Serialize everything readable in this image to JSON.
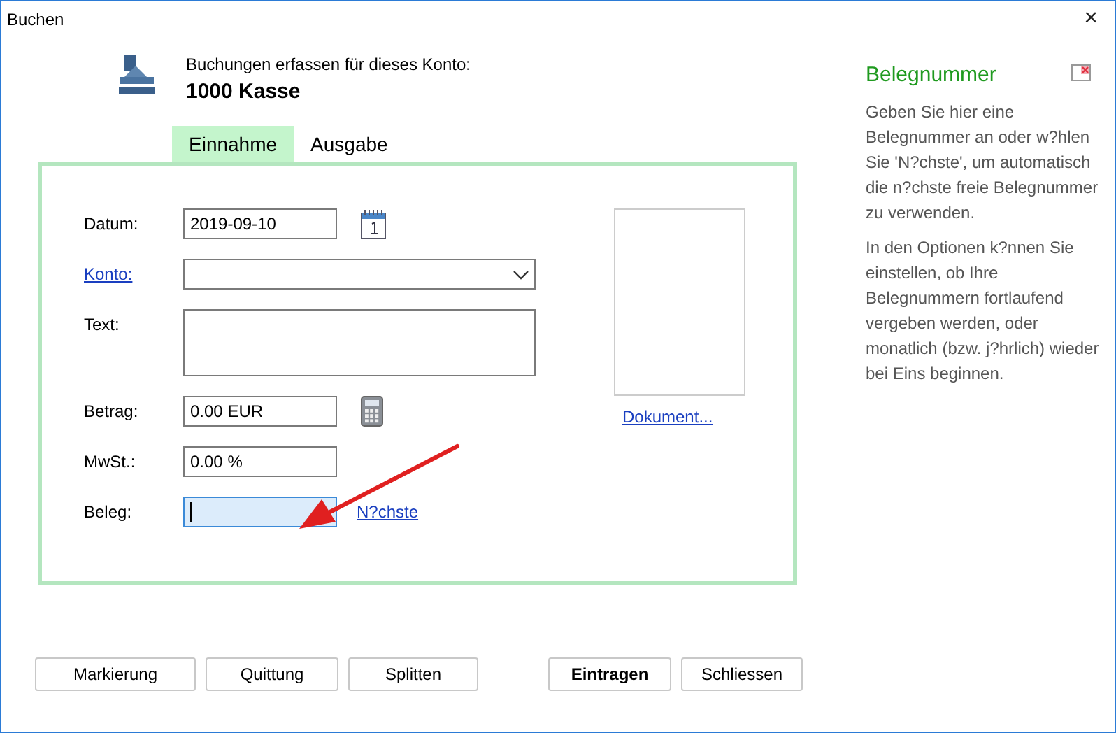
{
  "window": {
    "title": "Buchen",
    "close": "×"
  },
  "header": {
    "caption": "Buchungen erfassen für dieses Konto:",
    "account": "1000 Kasse"
  },
  "tabs": [
    {
      "label": "Einnahme",
      "selected": true
    },
    {
      "label": "Ausgabe",
      "selected": false
    }
  ],
  "form": {
    "fields": [
      {
        "label": "Datum:",
        "label_link": false,
        "kind": "text",
        "value": "2019-09-10",
        "focused": false,
        "action": {
          "kind": "calendar"
        }
      },
      {
        "label": "Konto:",
        "label_link": true,
        "kind": "dropdown",
        "focused": false
      },
      {
        "label": "Text:",
        "label_link": false,
        "kind": "textarea",
        "focused": false
      },
      {
        "label": "Betrag:",
        "label_link": false,
        "kind": "text",
        "value": "0.00 EUR",
        "focused": false,
        "action": {
          "kind": "calculator"
        }
      },
      {
        "label": "MwSt.:",
        "label_link": false,
        "kind": "text",
        "value": "0.00 %",
        "focused": false
      },
      {
        "label": "Beleg:",
        "label_link": false,
        "kind": "text",
        "focused": true,
        "action": {
          "kind": "link",
          "text": "N?chste"
        }
      }
    ],
    "document": {
      "link": "Dokument..."
    }
  },
  "buttons": [
    {
      "label": "Markierung",
      "default": false
    },
    {
      "label": "Quittung",
      "default": false
    },
    {
      "label": "Splitten",
      "default": false
    },
    {
      "label": "Eintragen",
      "default": true
    },
    {
      "label": "Schliessen",
      "default": false
    }
  ],
  "help": {
    "title": "Belegnummer",
    "paragraphs": [
      "Geben Sie hier eine Belegnummer an oder w?hlen Sie 'N?chste', um automatisch die n?chste freie Belegnummer zu verwenden.",
      "In den Optionen k?nnen Sie einstellen, ob Ihre Belegnummern fortlaufend vergeben werden, oder monatlich (bzw. j?hrlich) wieder bei Eins beginnen."
    ]
  }
}
